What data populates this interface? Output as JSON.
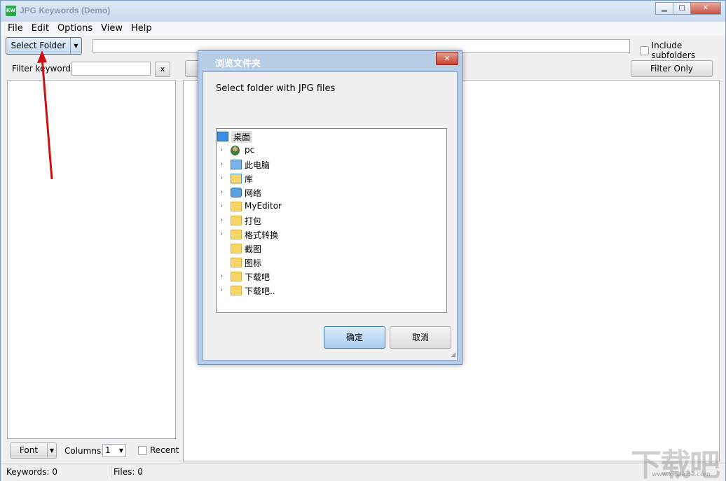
{
  "window": {
    "title": "JPG Keywords (Demo)",
    "icon_text": "KW"
  },
  "menu": [
    "File",
    "Edit",
    "Options",
    "View",
    "Help"
  ],
  "toolbar": {
    "select_folder": "Select Folder",
    "include_subfolders": "Include subfolders",
    "path_value": ""
  },
  "left": {
    "filter_label": "Filter keywords",
    "clear_label": "x",
    "font_label": "Font",
    "columns_label": "Columns:",
    "columns_value": "1",
    "recent_label": "Recent"
  },
  "right": {
    "filter_selected_label": "Filter Only Selected"
  },
  "status": {
    "keywords": "Keywords: 0",
    "files": "Files: 0"
  },
  "dialog": {
    "title": "浏览文件夹",
    "prompt": "Select folder with JPG files",
    "ok": "确定",
    "cancel": "取消",
    "tree": [
      {
        "label": "桌面",
        "icon": "desktop-icon",
        "expander": false,
        "selected": true,
        "indent": 0
      },
      {
        "label": "pc",
        "icon": "user-icon",
        "expander": true,
        "indent": 1
      },
      {
        "label": "此电脑",
        "icon": "computer-icon",
        "expander": true,
        "indent": 1
      },
      {
        "label": "库",
        "icon": "library-icon",
        "expander": true,
        "indent": 1
      },
      {
        "label": "网络",
        "icon": "network-icon",
        "expander": true,
        "indent": 1
      },
      {
        "label": "MyEditor",
        "icon": "folder-icon",
        "expander": true,
        "indent": 1
      },
      {
        "label": "打包",
        "icon": "folder-icon",
        "expander": true,
        "indent": 1
      },
      {
        "label": "格式转换",
        "icon": "folder-icon",
        "expander": true,
        "indent": 1
      },
      {
        "label": "截图",
        "icon": "folder-icon",
        "expander": false,
        "indent": 1
      },
      {
        "label": "图标",
        "icon": "folder-icon",
        "expander": false,
        "indent": 1
      },
      {
        "label": "下载吧",
        "icon": "folder-icon",
        "expander": true,
        "indent": 1
      },
      {
        "label": "下载吧..",
        "icon": "folder-icon",
        "expander": true,
        "indent": 1
      }
    ]
  },
  "watermark": {
    "text": "下载吧",
    "sub": "www.xiazaiba.com"
  },
  "colors": {
    "accent": "#3c7fb1",
    "title_bar": "#c9d9ee",
    "annotation_arrow": "#d01010"
  }
}
